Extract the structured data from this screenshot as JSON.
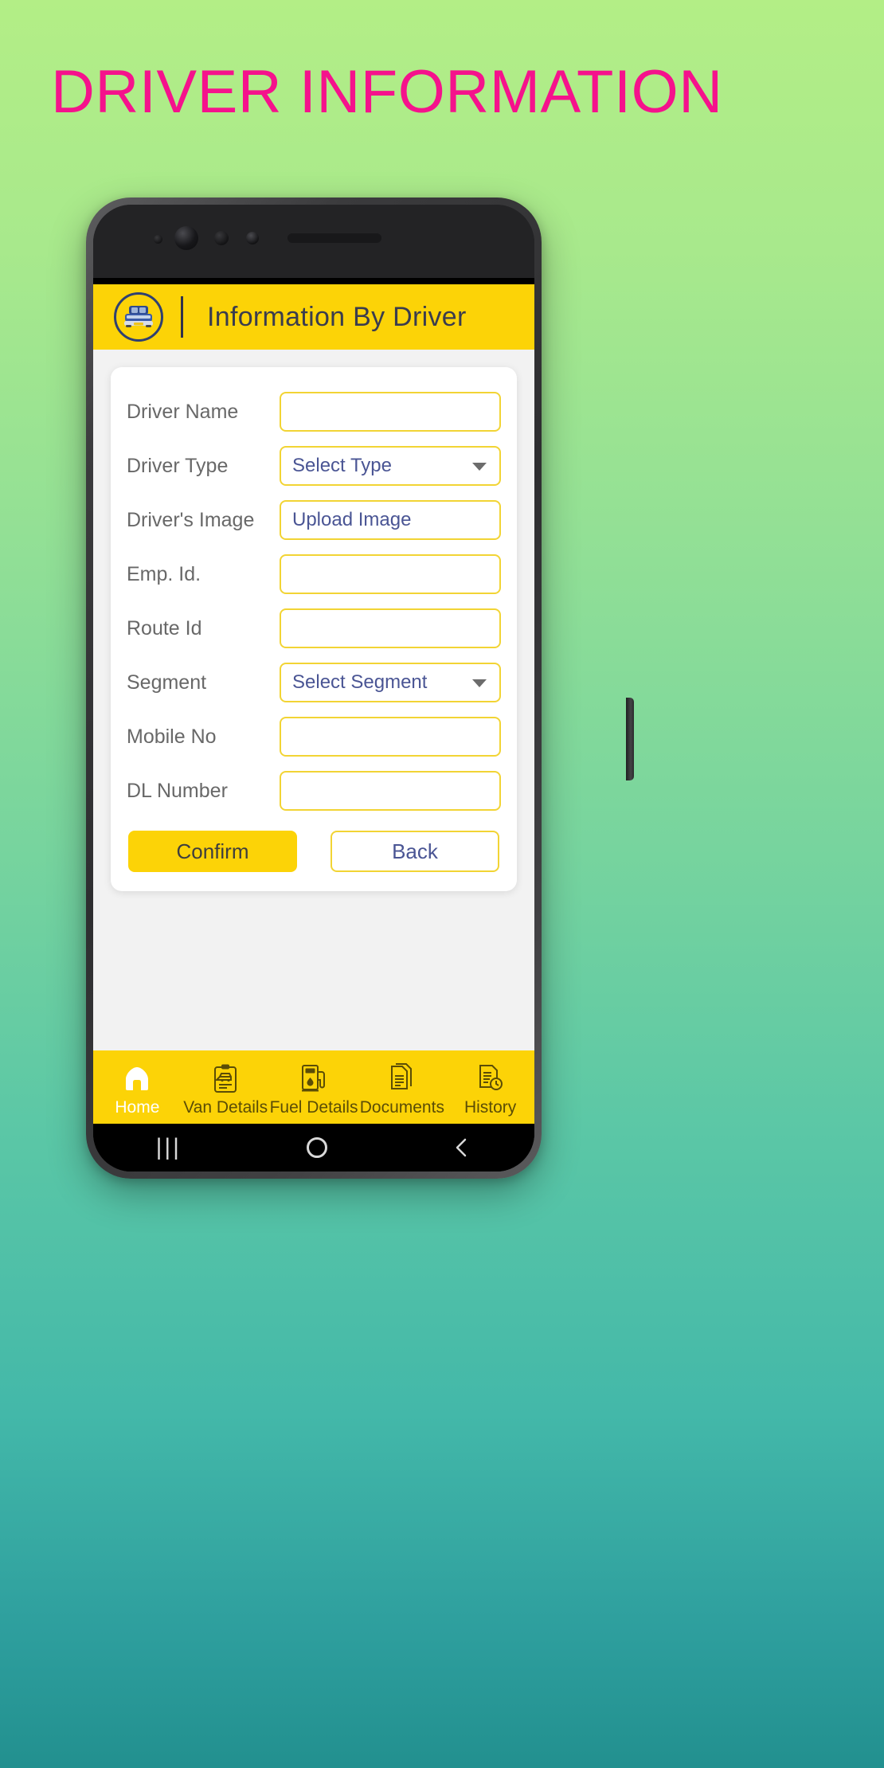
{
  "page": {
    "title": "DRIVER INFORMATION",
    "title_color": "#f5128c",
    "background_top_color": "#b3ee86",
    "background_bottom_color": "#22908f"
  },
  "app": {
    "accent_yellow": "#fcd307",
    "field_border": "#f2d434",
    "value_text_color": "#4a5594",
    "label_text_color": "#686868",
    "header": {
      "title": "Information By Driver",
      "logo_icon": "vehicle-in-circle-icon"
    },
    "form": {
      "fields": [
        {
          "label": "Driver Name",
          "value": "",
          "type": "text",
          "empty": true
        },
        {
          "label": "Driver Type",
          "value": "Select Type",
          "type": "select",
          "empty": false
        },
        {
          "label": "Driver's Image",
          "value": "Upload Image",
          "type": "text",
          "empty": false
        },
        {
          "label": "Emp. Id.",
          "value": "",
          "type": "text",
          "empty": true
        },
        {
          "label": "Route Id",
          "value": "",
          "type": "text",
          "empty": true
        },
        {
          "label": "Segment",
          "value": "Select Segment",
          "type": "select",
          "empty": false
        },
        {
          "label": "Mobile No",
          "value": "",
          "type": "text",
          "empty": true
        },
        {
          "label": "DL Number",
          "value": "",
          "type": "text",
          "empty": true
        }
      ],
      "confirm_label": "Confirm",
      "back_label": "Back"
    },
    "tabbar": {
      "items": [
        {
          "label": "Home",
          "icon": "home-icon",
          "active": true
        },
        {
          "label": "Van Details",
          "icon": "clipboard-van-icon",
          "active": false
        },
        {
          "label": "Fuel Details",
          "icon": "fuel-pump-icon",
          "active": false
        },
        {
          "label": "Documents",
          "icon": "documents-icon",
          "active": false
        },
        {
          "label": "History",
          "icon": "document-clock-icon",
          "active": false
        }
      ]
    }
  },
  "device": {
    "navbar": {
      "recent_label": "|||",
      "home_icon": "circle-icon",
      "back_icon": "chevron-left-icon"
    }
  }
}
